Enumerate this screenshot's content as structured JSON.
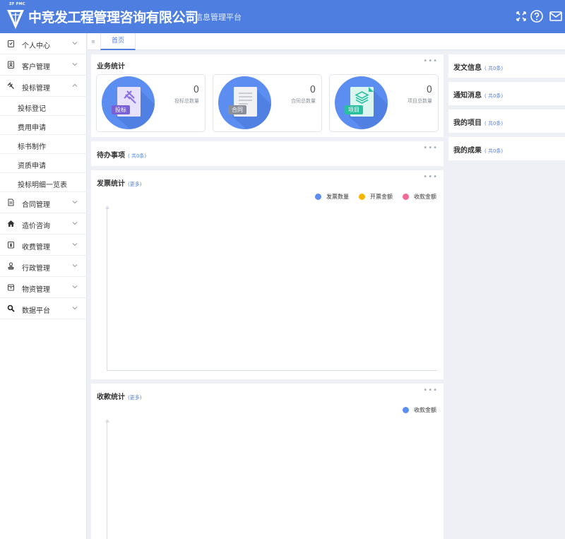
{
  "header": {
    "logo_abbr": "ZF PMC",
    "company_name": "中竞发工程管理咨询有限公司",
    "platform_name": "信息管理平台",
    "icons": [
      "fullscreen-icon",
      "help-icon",
      "mail-icon"
    ]
  },
  "sidebar": {
    "items": [
      {
        "label": "个人中心",
        "icon": "clipboard-icon"
      },
      {
        "label": "客户管理",
        "icon": "contact-icon"
      },
      {
        "label": "投标管理",
        "icon": "gavel-icon",
        "expanded": true
      },
      {
        "label": "合同管理",
        "icon": "document-icon"
      },
      {
        "label": "造价咨询",
        "icon": "home-icon"
      },
      {
        "label": "收费管理",
        "icon": "money-icon"
      },
      {
        "label": "行政管理",
        "icon": "stamp-icon"
      },
      {
        "label": "物资管理",
        "icon": "box-icon"
      },
      {
        "label": "数据平台",
        "icon": "search-icon"
      }
    ],
    "subitems": [
      "投标登记",
      "费用申请",
      "标书制作",
      "资质申请",
      "投标明细一览表"
    ]
  },
  "tabs": {
    "toggle": "≡",
    "home": "首页"
  },
  "business": {
    "title": "业务统计",
    "stats": [
      {
        "tag": "投标",
        "value": "0",
        "label": "投标总数量",
        "tag_color": "#7a5fd6"
      },
      {
        "tag": "合同",
        "value": "0",
        "label": "合同总数量",
        "tag_color": "#8a8f99"
      },
      {
        "tag": "项目",
        "value": "0",
        "label": "项目总数量",
        "tag_color": "#2bbfa2"
      }
    ]
  },
  "todo": {
    "title": "待办事项",
    "count": "( 共0条)"
  },
  "invoice": {
    "title": "发票统计",
    "more": "(更多)",
    "legend": [
      {
        "name": "发票数量",
        "color": "#5b8ef0"
      },
      {
        "name": "开票金额",
        "color": "#f5b800"
      },
      {
        "name": "收款金额",
        "color": "#ef6b94"
      }
    ]
  },
  "receipt": {
    "title": "收款统计",
    "more": "(更多)",
    "legend": [
      {
        "name": "收款金额",
        "color": "#5b8ef0"
      }
    ]
  },
  "right_panels": [
    {
      "title": "发文信息",
      "count": "( 共0条)"
    },
    {
      "title": "通知消息",
      "count": "( 共0条)"
    },
    {
      "title": "我的项目",
      "count": "( 共0条)"
    },
    {
      "title": "我的成果",
      "count": "( 共0条)"
    }
  ],
  "more_menu": "•••",
  "colors": {
    "brand": "#4d7ee0",
    "circle": "#5b8ef0"
  }
}
